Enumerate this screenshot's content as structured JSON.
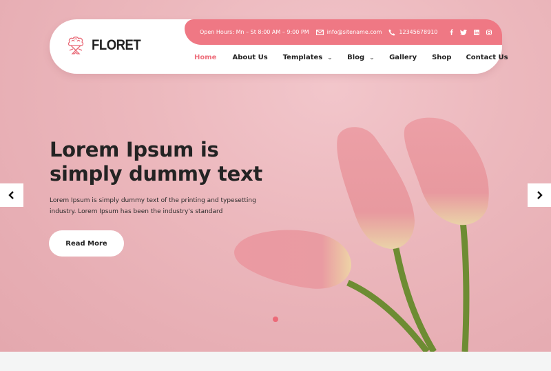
{
  "brand": {
    "name": "FLORET",
    "accent": "#ef7884"
  },
  "topbar": {
    "hours": "Open Hours: Mn – St 8:00 AM – 9:00 PM",
    "email": "info@sitename.com",
    "phone": "12345678910",
    "socials": [
      {
        "icon": "facebook-icon",
        "glyph": "f"
      },
      {
        "icon": "twitter-icon",
        "glyph": "t"
      },
      {
        "icon": "linkedin-icon",
        "glyph": "in"
      },
      {
        "icon": "instagram-icon",
        "glyph": "ig"
      }
    ]
  },
  "nav": {
    "items": [
      {
        "label": "Home",
        "active": true,
        "dropdown": false
      },
      {
        "label": "About Us",
        "active": false,
        "dropdown": false
      },
      {
        "label": "Templates",
        "active": false,
        "dropdown": true
      },
      {
        "label": "Blog",
        "active": false,
        "dropdown": true
      },
      {
        "label": "Gallery",
        "active": false,
        "dropdown": false
      },
      {
        "label": "Shop",
        "active": false,
        "dropdown": false
      },
      {
        "label": "Contact Us",
        "active": false,
        "dropdown": false
      }
    ]
  },
  "hero": {
    "headline": "Lorem Ipsum is simply dummy text",
    "subtext": "Lorem Ipsum is simply dummy text of the printing and typesetting industry. Lorem Ipsum has been the industry's standard",
    "button_label": "Read More",
    "slide_count": 1,
    "active_slide": 1
  }
}
